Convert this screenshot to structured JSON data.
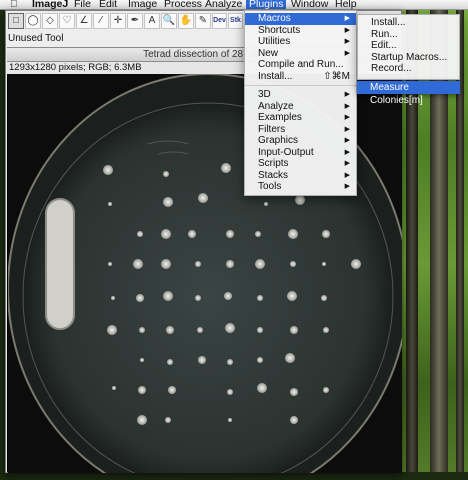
{
  "menubar": {
    "apple": "",
    "app": "ImageJ",
    "items": [
      "File",
      "Edit",
      "Image",
      "Process",
      "Analyze",
      "Plugins",
      "Window",
      "Help"
    ],
    "active": "Plugins"
  },
  "toolbar": {
    "tool_glyphs": [
      "□",
      "◯",
      "◇",
      "♡",
      "∠",
      "⁄",
      "✛",
      "✒",
      "A",
      "🔍",
      "✋",
      "✎"
    ],
    "dev_label": "Dev",
    "stk_label": "Stk"
  },
  "imagej_window": {
    "status": "Unused Tool",
    "image_title": "Tetrad dissection of 287-1...",
    "image_info": "1293x1280 pixels; RGB; 6.3MB",
    "window_title": "ImageJ"
  },
  "plugins_menu": {
    "items": [
      {
        "label": "Macros",
        "submenu": true,
        "selected": true
      },
      {
        "label": "Shortcuts",
        "submenu": true
      },
      {
        "label": "Utilities",
        "submenu": true
      },
      {
        "label": "New",
        "submenu": true
      },
      {
        "label": "Compile and Run..."
      },
      {
        "label": "Install...",
        "shortcut": "⇧⌘M"
      },
      {
        "separator": true
      },
      {
        "label": "3D",
        "submenu": true
      },
      {
        "label": "Analyze",
        "submenu": true
      },
      {
        "label": "Examples",
        "submenu": true
      },
      {
        "label": "Filters",
        "submenu": true
      },
      {
        "label": "Graphics",
        "submenu": true
      },
      {
        "label": "Input-Output",
        "submenu": true
      },
      {
        "label": "Scripts",
        "submenu": true
      },
      {
        "label": "Stacks",
        "submenu": true
      },
      {
        "label": "Tools",
        "submenu": true
      }
    ]
  },
  "macros_submenu": {
    "items": [
      "Install...",
      "Run...",
      "Edit...",
      "Startup Macros...",
      "Record..."
    ]
  },
  "colonies_submenu": {
    "item": "Measure Colonies[m]"
  },
  "colors": {
    "selection": "#2f6ad6"
  }
}
